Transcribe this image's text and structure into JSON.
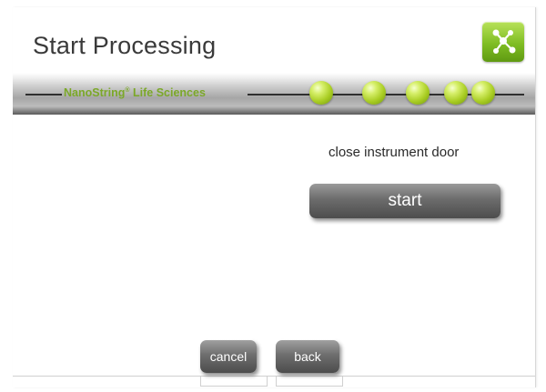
{
  "header": {
    "title": "Start Processing",
    "app_icon": "network-nodes-icon",
    "accent": "#8cc63f"
  },
  "banner": {
    "brand": "NanoString",
    "brand_mark": "®",
    "brand_suffix": " Life Sciences",
    "brand_color": "#7ba828",
    "progress_dots": 5
  },
  "main": {
    "instruction": "close instrument door",
    "start_label": "start"
  },
  "footer": {
    "cancel_label": "cancel",
    "back_label": "back"
  }
}
